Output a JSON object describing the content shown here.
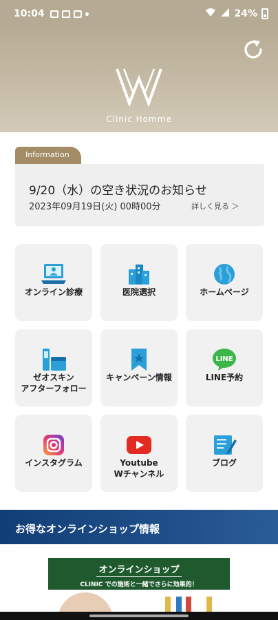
{
  "status_bar": {
    "time": "10:04",
    "battery": "24%"
  },
  "header": {
    "brand": "Clinic Homme"
  },
  "info": {
    "tab_label": "Information",
    "title": "9/20（水）の空き状況のお知らせ",
    "date": "2023年09月19日(火) 00時00分",
    "more_label": "詳しく見る ＞"
  },
  "menu": {
    "items": [
      {
        "label": "オンライン診療",
        "icon": "laptop-icon"
      },
      {
        "label": "医院選択",
        "icon": "building-icon"
      },
      {
        "label": "ホームページ",
        "icon": "globe-icon"
      },
      {
        "label": "ゼオスキン\nアフターフォロー",
        "icon": "skincare-icon"
      },
      {
        "label": "キャンペーン情報",
        "icon": "bookmark-icon"
      },
      {
        "label": "LINE予約",
        "icon": "line-icon",
        "icon_text": "LINE"
      },
      {
        "label": "インスタグラム",
        "icon": "instagram-icon"
      },
      {
        "label": "Youtube\nWチャンネル",
        "icon": "youtube-icon"
      },
      {
        "label": "ブログ",
        "icon": "blog-icon"
      }
    ]
  },
  "promo": {
    "label": "お得なオンラインショップ情報"
  },
  "shop_banner": {
    "title": "オンラインショップ",
    "subtitle": "CLINIC での施術と一緒でさらに効果的！"
  },
  "colors": {
    "header": "#b7ab93",
    "tab": "#a48d66",
    "promo": "#123e76",
    "tile": "#f1f1f1",
    "accent_blue": "#1a88d0"
  }
}
